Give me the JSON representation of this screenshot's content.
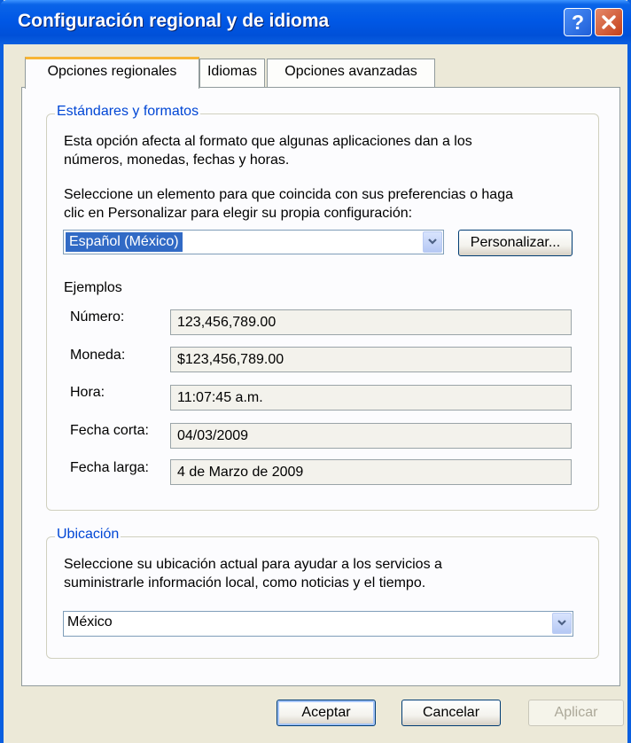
{
  "window": {
    "title": "Configuración regional y de idioma",
    "help_glyph": "?",
    "close_icon": "close-icon",
    "accent_color": "#0a5fe0"
  },
  "tabs": [
    {
      "label": "Opciones regionales",
      "active": true
    },
    {
      "label": "Idiomas",
      "active": false
    },
    {
      "label": "Opciones avanzadas",
      "active": false
    }
  ],
  "standards": {
    "legend": "Estándares y formatos",
    "description_line1": "Esta opción afecta al formato que algunas aplicaciones dan a los",
    "description_line2": "números, monedas, fechas y horas.",
    "select_line1": "Seleccione un elemento para que coincida con sus preferencias o haga",
    "select_line2": "clic en Personalizar para elegir su propia configuración:",
    "format_value": "Español (México)",
    "customize_label": "Personalizar...",
    "examples_heading": "Ejemplos",
    "examples": [
      {
        "label": "Número:",
        "value": "123,456,789.00"
      },
      {
        "label": "Moneda:",
        "value": "$123,456,789.00"
      },
      {
        "label": "Hora:",
        "value": "11:07:45 a.m."
      },
      {
        "label": "Fecha corta:",
        "value": "04/03/2009"
      },
      {
        "label": "Fecha larga:",
        "value": "4 de Marzo de 2009"
      }
    ]
  },
  "location": {
    "legend": "Ubicación",
    "description_line1": "Seleccione su ubicación actual para ayudar a los servicios a",
    "description_line2": "suministrarle información local, como noticias y el tiempo.",
    "value": "México"
  },
  "buttons": {
    "ok": "Aceptar",
    "cancel": "Cancelar",
    "apply": "Aplicar"
  }
}
